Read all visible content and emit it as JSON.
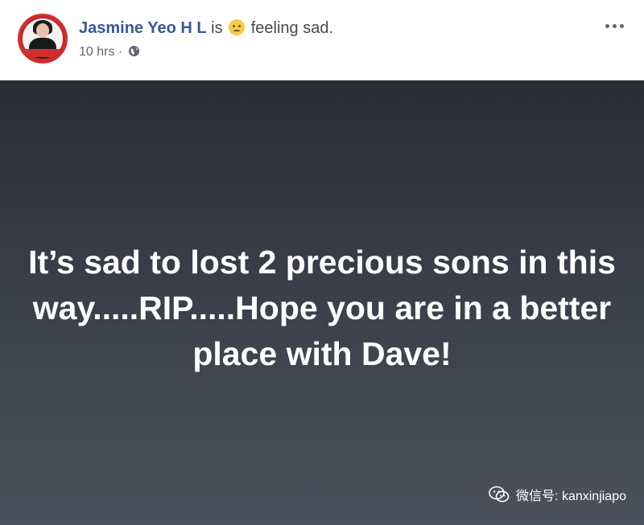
{
  "post": {
    "author": "Jasmine Yeo H L",
    "feeling_prefix": "is",
    "feeling_emoji": "sad-face-icon",
    "feeling_text": "feeling sad.",
    "time": "10 hrs",
    "time_separator": "·",
    "privacy": "globe-icon",
    "more_menu": "more-options-icon",
    "text": "It’s sad to lost 2 precious sons in this way.....RIP.....Hope you are in a better place with Dave!"
  },
  "watermark": {
    "text": "微信号: kanxinjiapo"
  },
  "colors": {
    "author_link": "#385898",
    "meta_text": "#616770",
    "background_top": "#2a2d35",
    "background_bottom": "#4c515d",
    "post_text": "#ffffff"
  }
}
